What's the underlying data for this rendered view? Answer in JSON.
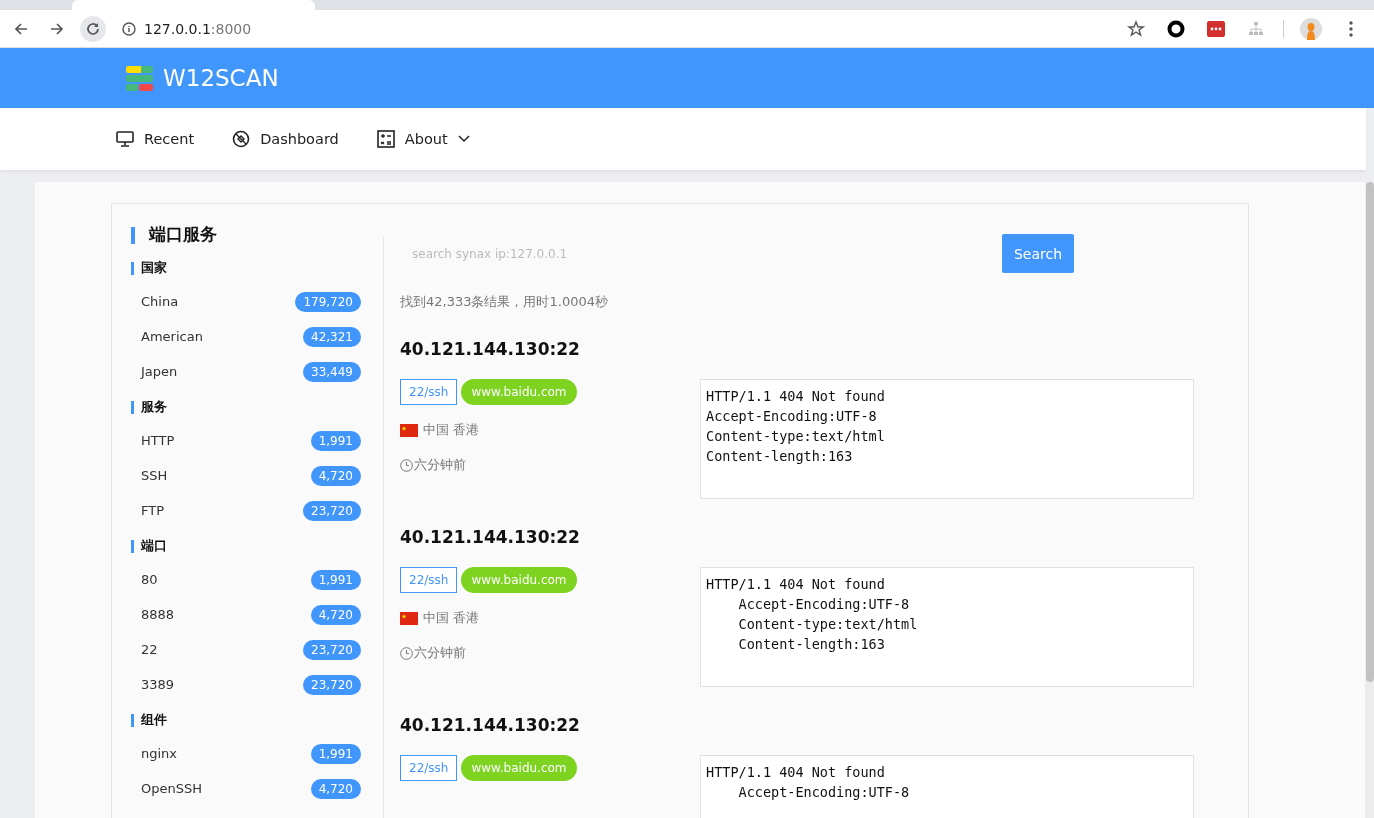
{
  "browser": {
    "address_host": "127.0.0.1",
    "address_port": ":8000"
  },
  "header": {
    "title": "W12SCAN"
  },
  "nav": [
    {
      "label": "Recent",
      "dropdown": false
    },
    {
      "label": "Dashboard",
      "dropdown": false
    },
    {
      "label": "About",
      "dropdown": true
    }
  ],
  "sidebar": {
    "title": "端口服务",
    "groups": [
      {
        "title": "国家",
        "items": [
          {
            "label": "China",
            "count": "179,720"
          },
          {
            "label": "American",
            "count": "42,321"
          },
          {
            "label": "Japen",
            "count": "33,449"
          }
        ]
      },
      {
        "title": "服务",
        "items": [
          {
            "label": "HTTP",
            "count": "1,991"
          },
          {
            "label": "SSH",
            "count": "4,720"
          },
          {
            "label": "FTP",
            "count": "23,720"
          }
        ]
      },
      {
        "title": "端口",
        "items": [
          {
            "label": "80",
            "count": "1,991"
          },
          {
            "label": "8888",
            "count": "4,720"
          },
          {
            "label": "22",
            "count": "23,720"
          },
          {
            "label": "3389",
            "count": "23,720"
          }
        ]
      },
      {
        "title": "组件",
        "items": [
          {
            "label": "nginx",
            "count": "1,991"
          },
          {
            "label": "OpenSSH",
            "count": "4,720"
          }
        ]
      }
    ]
  },
  "search": {
    "placeholder": "search synax ip:127.0.0.1",
    "button": "Search"
  },
  "summary": "找到42,333条结果，用时1.0004秒",
  "results": [
    {
      "address": "40.121.144.130:22",
      "port_tag": "22/ssh",
      "host_tag": "www.baidu.com",
      "location": "中国 香港",
      "time": "六分钟前",
      "headers": [
        "HTTP/1.1 404 Not found",
        "Accept-Encoding:UTF-8",
        "Content-type:text/html",
        "Content-length:163"
      ]
    },
    {
      "address": "40.121.144.130:22",
      "port_tag": "22/ssh",
      "host_tag": "www.baidu.com",
      "location": "中国 香港",
      "time": "六分钟前",
      "headers": [
        "HTTP/1.1 404 Not found",
        "    Accept-Encoding:UTF-8",
        "    Content-type:text/html",
        "    Content-length:163"
      ]
    },
    {
      "address": "40.121.144.130:22",
      "port_tag": "22/ssh",
      "host_tag": "www.baidu.com",
      "headers": [
        "HTTP/1.1 404 Not found",
        "    Accept-Encoding:UTF-8"
      ]
    }
  ]
}
